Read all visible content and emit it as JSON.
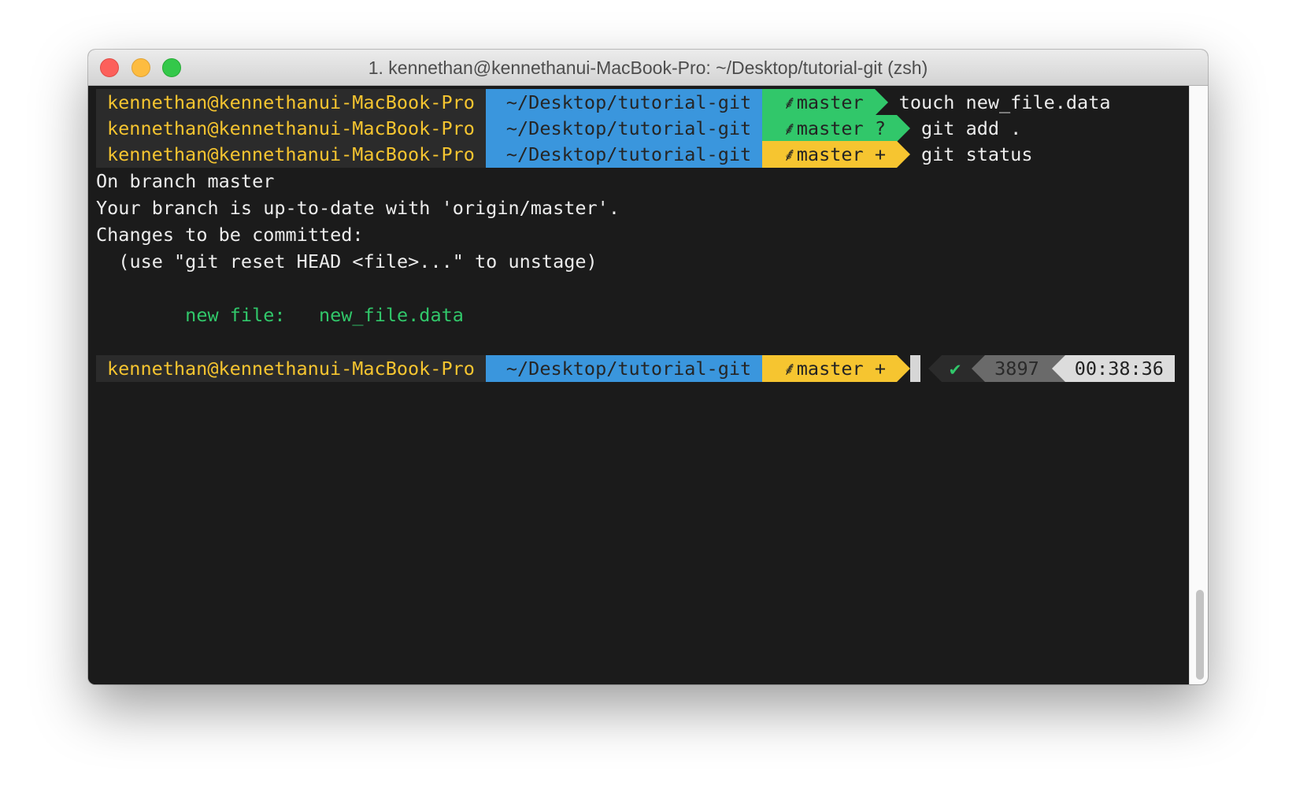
{
  "window": {
    "title": "1. kennethan@kennethanui-MacBook-Pro: ~/Desktop/tutorial-git (zsh)"
  },
  "colors": {
    "user_fg": "#f6c530",
    "dir_bg": "#3a96dd",
    "branch_clean_bg": "#31c76a",
    "branch_dirty_bg": "#f6c530",
    "added_file": "#31c76a"
  },
  "prompts": [
    {
      "user": "kennethan@kennethanui-MacBook-Pro",
      "dir": "~/Desktop/tutorial-git",
      "branch": "master",
      "branch_icon": "git-branch-icon",
      "marker": "",
      "state": "clean",
      "command": "touch new_file.data"
    },
    {
      "user": "kennethan@kennethanui-MacBook-Pro",
      "dir": "~/Desktop/tutorial-git",
      "branch": "master",
      "branch_icon": "git-branch-icon",
      "marker": "?",
      "state": "untracked",
      "command": "git add ."
    },
    {
      "user": "kennethan@kennethanui-MacBook-Pro",
      "dir": "~/Desktop/tutorial-git",
      "branch": "master",
      "branch_icon": "git-branch-icon",
      "marker": "+",
      "state": "staged",
      "command": "git status"
    }
  ],
  "output": [
    "On branch master",
    "Your branch is up-to-date with 'origin/master'.",
    "Changes to be committed:",
    "  (use \"git reset HEAD <file>...\" to unstage)",
    "",
    "        new file:   new_file.data"
  ],
  "current_prompt": {
    "user": "kennethan@kennethanui-MacBook-Pro",
    "dir": "~/Desktop/tutorial-git",
    "branch": "master",
    "marker": "+",
    "status_check": "✔",
    "history_number": "3897",
    "time": "00:38:36"
  }
}
